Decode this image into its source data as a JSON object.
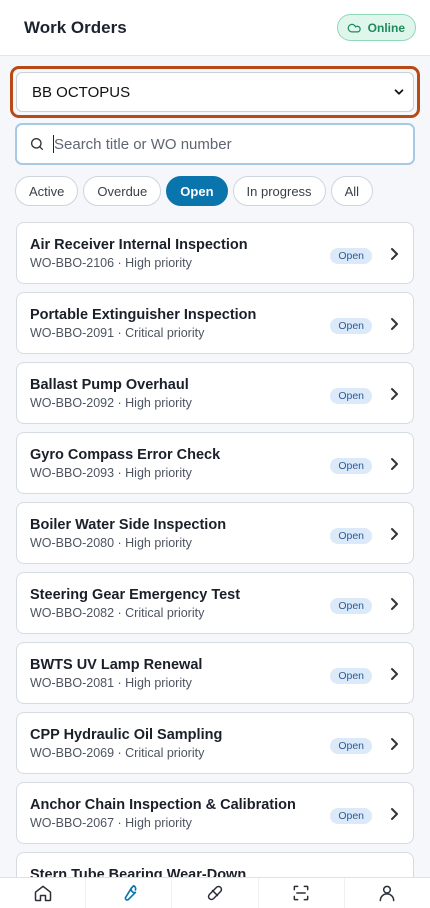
{
  "header": {
    "title": "Work Orders",
    "status_label": "Online"
  },
  "vessel_select": {
    "selected": "BB OCTOPUS"
  },
  "search": {
    "placeholder": "Search title or WO number"
  },
  "filters": [
    {
      "label": "Active",
      "active": false
    },
    {
      "label": "Overdue",
      "active": false
    },
    {
      "label": "Open",
      "active": true
    },
    {
      "label": "In progress",
      "active": false
    },
    {
      "label": "All",
      "active": false
    }
  ],
  "work_orders": [
    {
      "title": "Air Receiver Internal Inspection",
      "subtitle": "WO-BBO-2106 · High priority",
      "status": "Open"
    },
    {
      "title": "Portable Extinguisher Inspection",
      "subtitle": "WO-BBO-2091 · Critical priority",
      "status": "Open"
    },
    {
      "title": "Ballast Pump Overhaul",
      "subtitle": "WO-BBO-2092 · High priority",
      "status": "Open"
    },
    {
      "title": "Gyro Compass Error Check",
      "subtitle": "WO-BBO-2093 · High priority",
      "status": "Open"
    },
    {
      "title": "Boiler Water Side Inspection",
      "subtitle": "WO-BBO-2080 · High priority",
      "status": "Open"
    },
    {
      "title": "Steering Gear Emergency Test",
      "subtitle": "WO-BBO-2082 · Critical priority",
      "status": "Open"
    },
    {
      "title": "BWTS UV Lamp Renewal",
      "subtitle": "WO-BBO-2081 · High priority",
      "status": "Open"
    },
    {
      "title": "CPP Hydraulic Oil Sampling",
      "subtitle": "WO-BBO-2069 · Critical priority",
      "status": "Open"
    },
    {
      "title": "Anchor Chain Inspection & Calibration",
      "subtitle": "WO-BBO-2067 · High priority",
      "status": "Open"
    },
    {
      "title": "Stern Tube Bearing Wear-Down",
      "subtitle": "",
      "status": ""
    }
  ],
  "bottom_nav": [
    {
      "icon": "home-icon",
      "active": false
    },
    {
      "icon": "wrench-icon",
      "active": true
    },
    {
      "icon": "capsule-icon",
      "active": false
    },
    {
      "icon": "scan-icon",
      "active": false
    },
    {
      "icon": "user-icon",
      "active": false
    }
  ],
  "colors": {
    "accent": "#0a74ad",
    "focus_outline": "#b84a16",
    "online_bg": "#dff6ec",
    "online_text": "#1f8a5a"
  }
}
